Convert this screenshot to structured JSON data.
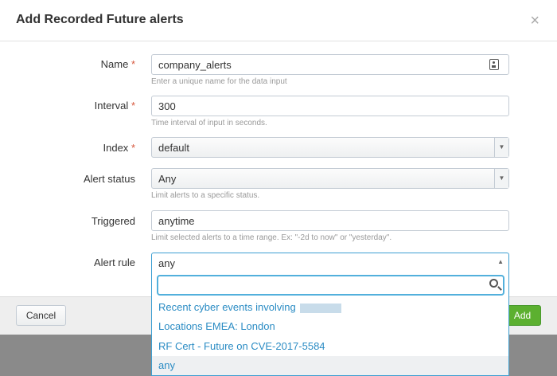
{
  "dialog": {
    "title": "Add Recorded Future alerts",
    "close_symbol": "×"
  },
  "form": {
    "name": {
      "label": "Name",
      "required_mark": "*",
      "value": "company_alerts",
      "help": "Enter a unique name for the data input"
    },
    "interval": {
      "label": "Interval",
      "required_mark": "*",
      "value": "300",
      "help": "Time interval of input in seconds."
    },
    "index": {
      "label": "Index",
      "required_mark": "*",
      "value": "default"
    },
    "alert_status": {
      "label": "Alert status",
      "value": "Any",
      "help": "Limit alerts to a specific status."
    },
    "triggered": {
      "label": "Triggered",
      "value": "anytime",
      "help": "Limit selected alerts to a time range. Ex: \"-2d to now\" or \"yesterday\"."
    },
    "alert_rule": {
      "label": "Alert rule",
      "value": "any",
      "search_value": "",
      "options": [
        "Recent cyber events involving",
        "Locations EMEA: London",
        "RF Cert - Future on CVE-2017-5584",
        "any"
      ]
    }
  },
  "footer": {
    "cancel_label": "Cancel",
    "add_label": "Add"
  },
  "colors": {
    "required": "#d6563c",
    "link": "#2b8cc4",
    "primary_button": "#5cb030",
    "focus_border": "#3d9fd2"
  },
  "icons": [
    "close-icon",
    "id-card-icon",
    "caret-down-icon",
    "caret-up-icon",
    "search-icon"
  ]
}
